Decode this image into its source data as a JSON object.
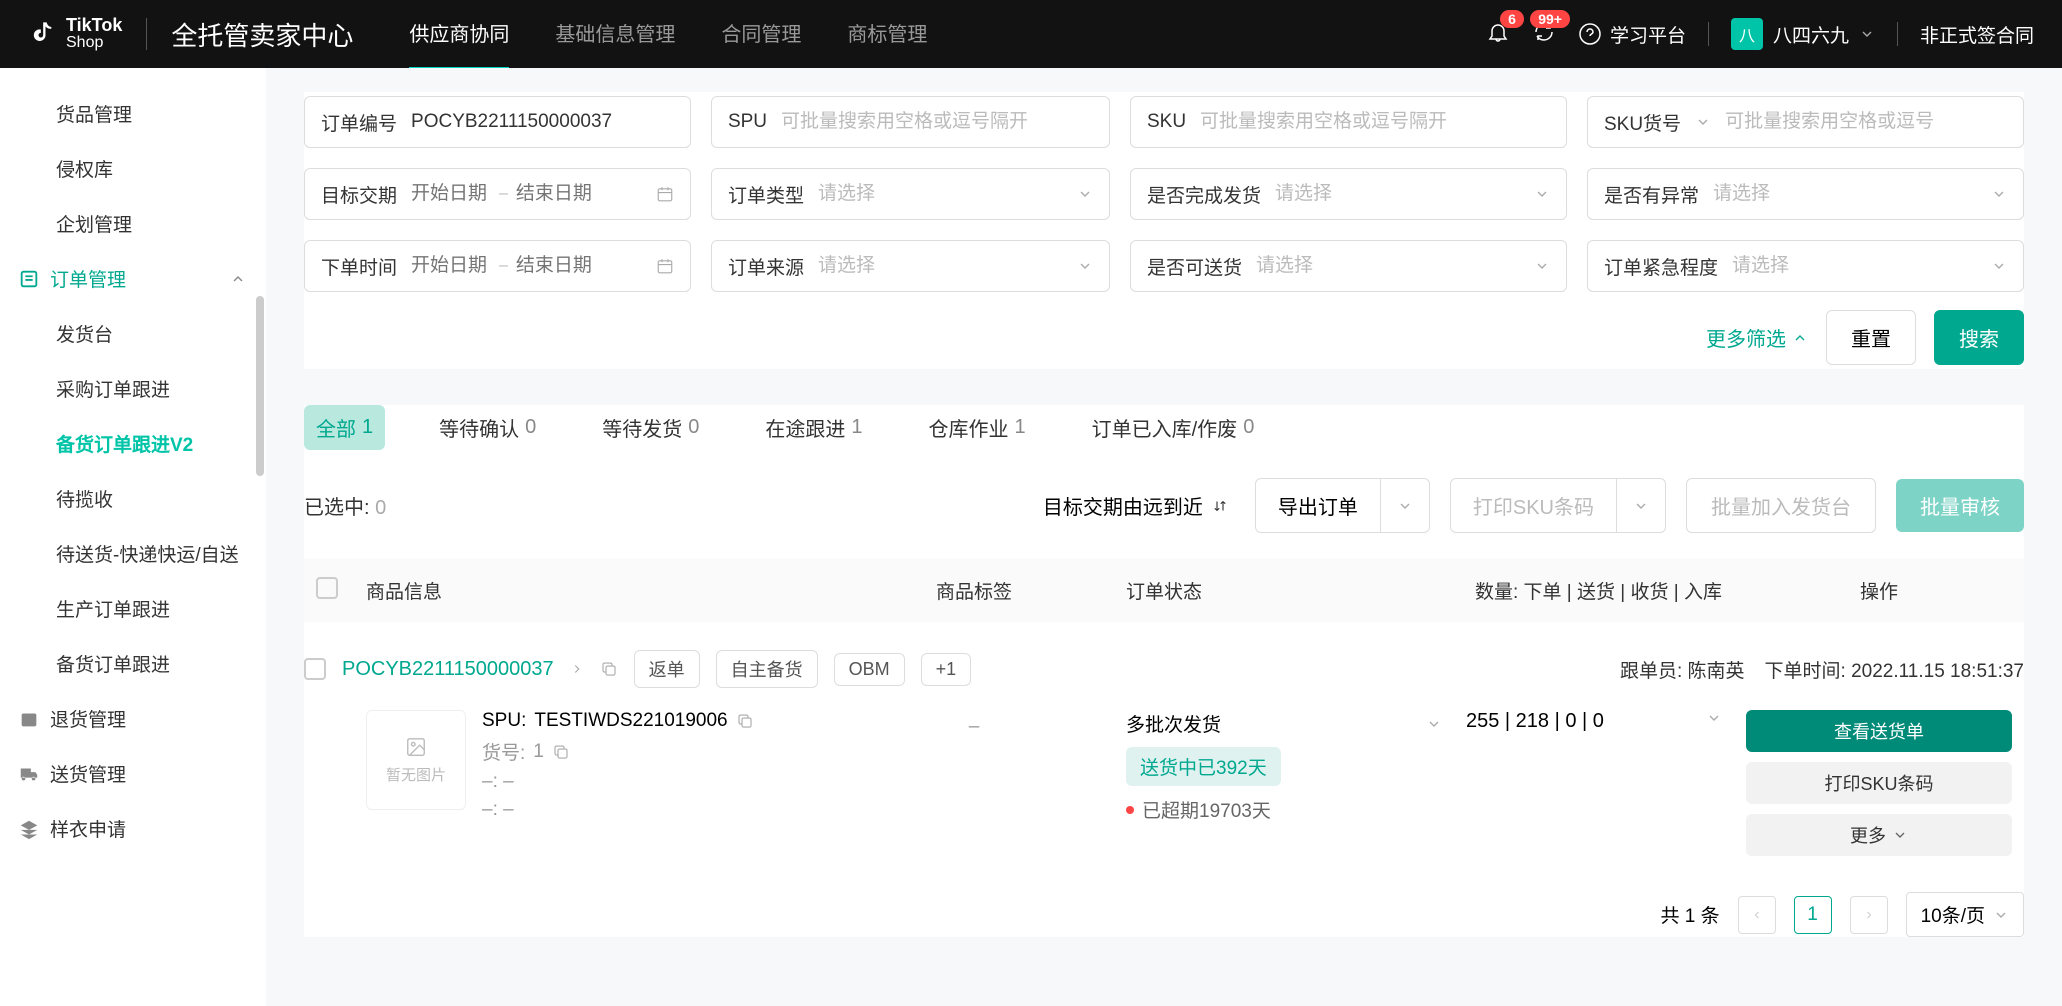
{
  "header": {
    "logo_text1": "TikTok",
    "logo_text2": "Shop",
    "app_title": "全托管卖家中心",
    "nav": [
      "供应商协同",
      "基础信息管理",
      "合同管理",
      "商标管理"
    ],
    "nav_active_index": 0,
    "notif_badge": "6",
    "refresh_badge": "99+",
    "learn_label": "学习平台",
    "user_badge": "八",
    "username": "八四六九",
    "contract_status": "非正式签合同"
  },
  "sidebar": {
    "items": [
      {
        "label": "货品管理",
        "level": 1
      },
      {
        "label": "侵权库",
        "level": 1
      },
      {
        "label": "企划管理",
        "level": 1
      },
      {
        "label": "订单管理",
        "level": 0,
        "icon": "list",
        "expanded": true
      },
      {
        "label": "发货台",
        "level": 1
      },
      {
        "label": "采购订单跟进",
        "level": 1
      },
      {
        "label": "备货订单跟进V2",
        "level": 1,
        "active": true
      },
      {
        "label": "待揽收",
        "level": 1
      },
      {
        "label": "待送货-快递快运/自送",
        "level": 1
      },
      {
        "label": "生产订单跟进",
        "level": 1
      },
      {
        "label": "备货订单跟进",
        "level": 1
      },
      {
        "label": "退货管理",
        "level": 0,
        "icon": "box"
      },
      {
        "label": "送货管理",
        "level": 0,
        "icon": "truck"
      },
      {
        "label": "样衣申请",
        "level": 0,
        "icon": "layers"
      }
    ]
  },
  "filters": {
    "order_no_label": "订单编号",
    "order_no_value": "POCYB2211150000037",
    "spu_label": "SPU",
    "spu_placeholder": "可批量搜索用空格或逗号隔开",
    "sku_label": "SKU",
    "sku_placeholder": "可批量搜索用空格或逗号隔开",
    "sku_code_label": "SKU货号",
    "sku_code_placeholder": "可批量搜索用空格或逗号",
    "target_date_label": "目标交期",
    "start_date_placeholder": "开始日期",
    "end_date_placeholder": "结束日期",
    "order_type_label": "订单类型",
    "ship_done_label": "是否完成发货",
    "has_exception_label": "是否有异常",
    "order_time_label": "下单时间",
    "order_source_label": "订单来源",
    "deliverable_label": "是否可送货",
    "urgency_label": "订单紧急程度",
    "select_placeholder": "请选择",
    "more_filters": "更多筛选",
    "reset": "重置",
    "search": "搜索"
  },
  "tabs": [
    {
      "label": "全部",
      "count": "1",
      "active": true
    },
    {
      "label": "等待确认",
      "count": "0"
    },
    {
      "label": "等待发货",
      "count": "0"
    },
    {
      "label": "在途跟进",
      "count": "1"
    },
    {
      "label": "仓库作业",
      "count": "1"
    },
    {
      "label": "订单已入库/作废",
      "count": "0"
    }
  ],
  "toolbar": {
    "selected_label": "已选中:",
    "selected_count": "0",
    "sort_label": "目标交期由远到近",
    "export_label": "导出订单",
    "print_sku_label": "打印SKU条码",
    "batch_ship_label": "批量加入发货台",
    "batch_review_label": "批量审核"
  },
  "table": {
    "columns": [
      "商品信息",
      "商品标签",
      "订单状态",
      "数量: 下单 | 送货 | 收货 | 入库",
      "操作"
    ],
    "order": {
      "id": "POCYB2211150000037",
      "chips": [
        "返单",
        "自主备货",
        "OBM",
        "+1"
      ],
      "tracker_label": "跟单员:",
      "tracker_name": "陈南英",
      "order_time_label": "下单时间:",
      "order_time": "2022.11.15 18:51:37",
      "spu_label": "SPU:",
      "spu_value": "TESTIWDS221019006",
      "sku_no_label": "货号:",
      "sku_no_value": "1",
      "no_image": "暂无图片",
      "dash1": "–:  –",
      "dash2": "–:  –",
      "tag_dash": "–",
      "status_title": "多批次发货",
      "status_tag": "送货中已392天",
      "overdue": "已超期19703天",
      "qty": "255 | 218 | 0 | 0",
      "action_view": "查看送货单",
      "action_print": "打印SKU条码",
      "action_more": "更多"
    }
  },
  "pagination": {
    "total": "共 1 条",
    "page": "1",
    "page_size": "10条/页"
  }
}
